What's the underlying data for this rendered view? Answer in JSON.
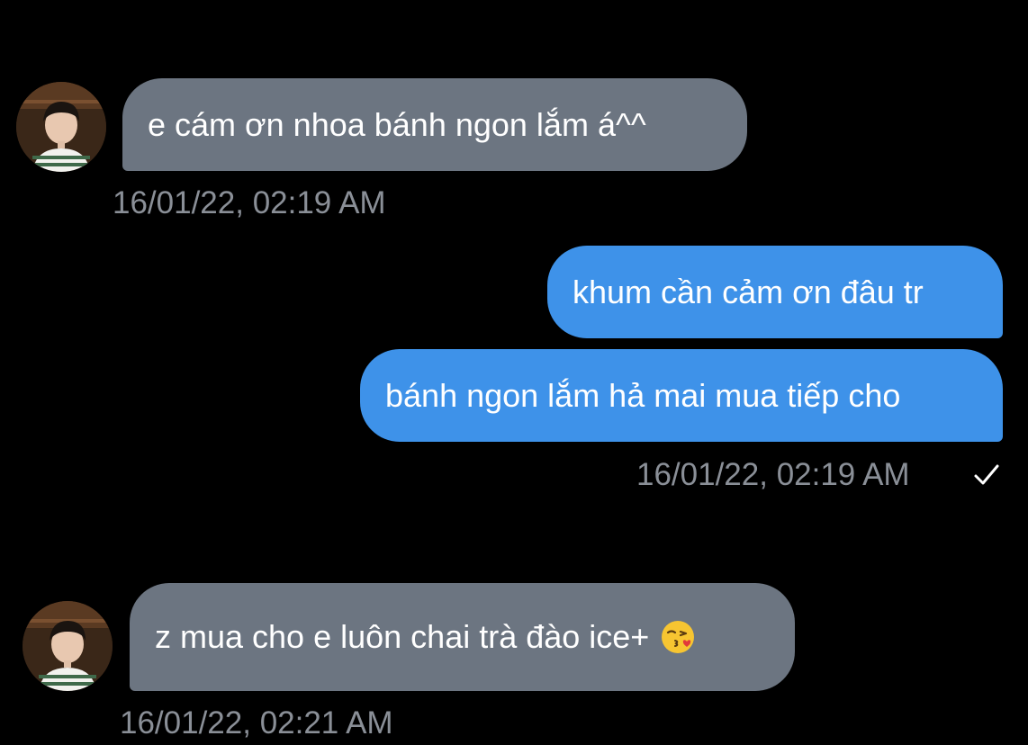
{
  "messages": [
    {
      "direction": "incoming",
      "text": "e cám ơn nhoa bánh ngon lắm á^^",
      "avatar": "contact-avatar"
    },
    {
      "direction": "incoming-timestamp",
      "timestamp": "16/01/22, 02:19 AM"
    },
    {
      "direction": "outgoing",
      "text": "khum cần cảm ơn đâu tr"
    },
    {
      "direction": "outgoing",
      "text": "bánh ngon lắm hả mai mua tiếp cho"
    },
    {
      "direction": "outgoing-timestamp",
      "timestamp": "16/01/22, 02:19 AM",
      "status_icon": "checkmark-icon"
    },
    {
      "direction": "incoming",
      "text": "z mua cho e luôn chai trà đào ice+",
      "emoji": "kissing-face-emoji",
      "avatar": "contact-avatar"
    },
    {
      "direction": "incoming-timestamp",
      "timestamp": "16/01/22, 02:21 AM"
    }
  ],
  "colors": {
    "background": "#000000",
    "incoming_bubble": "#6c7581",
    "outgoing_bubble": "#3e92e9",
    "timestamp_text": "#8a8f97",
    "message_text": "#ffffff"
  }
}
